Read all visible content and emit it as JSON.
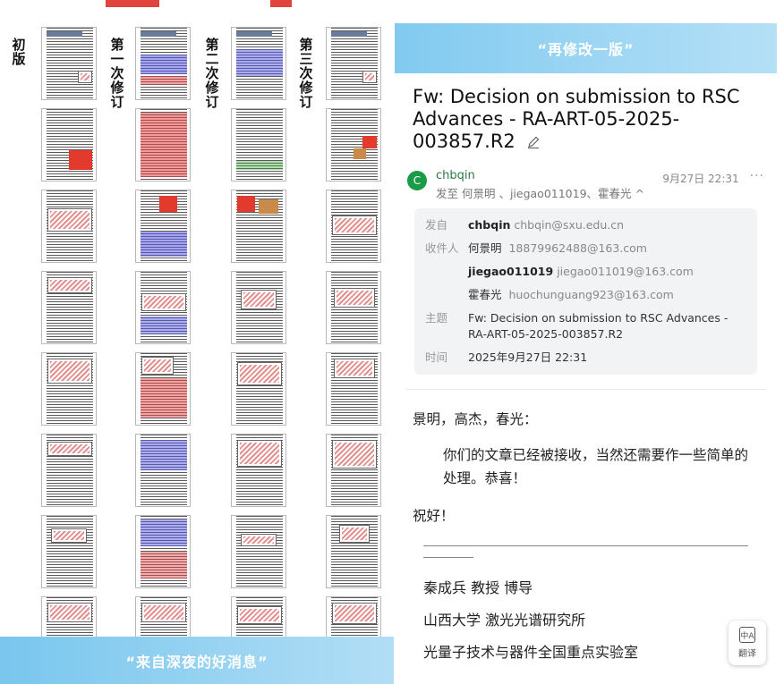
{
  "left": {
    "labels": [
      "初版",
      "第一次修订",
      "第二次修订",
      "第三次修订"
    ],
    "caption": "“来自深夜的好消息”"
  },
  "right": {
    "caption": "“再修改一版”",
    "subject": "Fw: Decision on submission to RSC Advances - RA-ART-05-2025-003857.R2",
    "sender": {
      "avatar_letter": "C",
      "name": "chbqin",
      "recipients_line": "发至 何景明 、jiegao011019、霍春光 ^",
      "time": "9月27日 22:31",
      "more": "···"
    },
    "details": {
      "from_label": "发自",
      "from_name": "chbqin",
      "from_email": "chbqin@sxu.edu.cn",
      "to_label": "收件人",
      "recipients": [
        {
          "name": "何景明",
          "email": "18879962488@163.com"
        },
        {
          "name": "jiegao011019",
          "email": "jiegao011019@163.com"
        },
        {
          "name": "霍春光",
          "email": "huochunguang923@163.com"
        }
      ],
      "subject_label": "主题",
      "subject": "Fw: Decision on submission to RSC Advances - RA-ART-05-2025-003857.R2",
      "time_label": "时间",
      "time": "2025年9月27日 22:31"
    },
    "body": {
      "greeting": "景明，高杰，春光：",
      "paragraph": "你们的文章已经被接收，当然还需要作一些简单的处理。恭喜！",
      "closing": "祝好！",
      "signature": [
        "秦成兵 教授 博导",
        "山西大学 激光光谱研究所",
        "光量子技术与器件全国重点实验室"
      ]
    },
    "translate": {
      "icon": "中A",
      "label": "翻译"
    }
  },
  "colors": {
    "accent": "#79c6ee",
    "sender": "#2a7a45",
    "avatar": "#1a9b47"
  }
}
